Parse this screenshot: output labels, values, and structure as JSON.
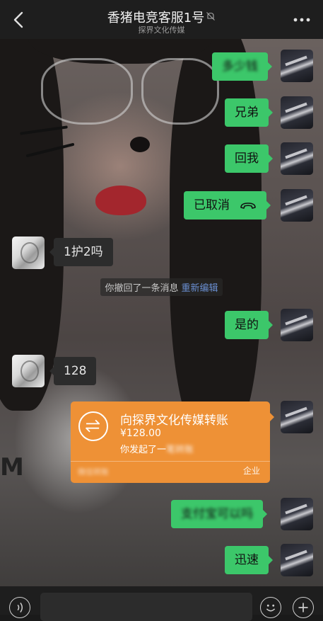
{
  "header": {
    "title": "香猪电竞客服1号",
    "subtitle": "探界文化传媒",
    "icons": [
      "back-icon",
      "mute-bell-icon",
      "more-icon"
    ]
  },
  "messages": [
    {
      "side": "me",
      "text": "多少钱",
      "blurred": true
    },
    {
      "side": "me",
      "text": "兄弟"
    },
    {
      "side": "me",
      "text": "回我"
    },
    {
      "side": "me",
      "text": "已取消",
      "icon": "phone-hangup-icon"
    },
    {
      "side": "other",
      "text": "1护2吗"
    },
    {
      "side": "system",
      "text": "你撤回了一条消息",
      "action": "重新编辑"
    },
    {
      "side": "me",
      "text": "是的"
    },
    {
      "side": "other",
      "text": "128"
    },
    {
      "side": "me",
      "type": "transfer"
    },
    {
      "side": "me",
      "text": "支付宝可以吗",
      "blurred": true
    },
    {
      "side": "me",
      "text": "迅速"
    }
  ],
  "transfer": {
    "title": "向探界文化传媒转账",
    "amount": "¥128.00",
    "status": "你发起了一",
    "status_blurred": "笔转账",
    "footer_left": "微信转账",
    "footer_right": "企业",
    "accent": "#ee9136"
  },
  "colors": {
    "my_bubble": "#3cc76a",
    "other_bubble": "#2c2c2c",
    "link": "#6a8fd2"
  },
  "bottom_bar": {
    "icons": [
      "voice-icon",
      "emoji-icon",
      "plus-icon"
    ]
  }
}
